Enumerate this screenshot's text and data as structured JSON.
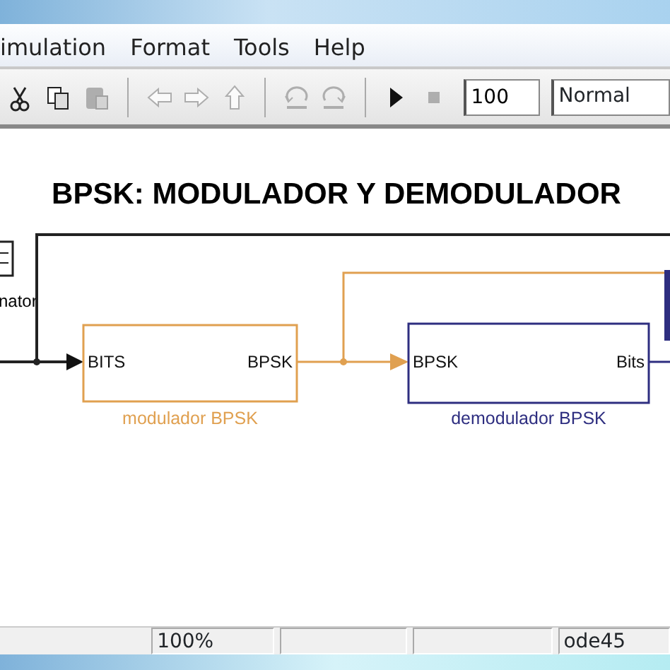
{
  "menu": [
    "imulation",
    "Format",
    "Tools",
    "Help"
  ],
  "toolbar": [
    {
      "kind": "cut",
      "disabled": false
    },
    {
      "kind": "copy",
      "disabled": false
    },
    {
      "kind": "paste",
      "disabled": true
    },
    {
      "kind": "sep"
    },
    {
      "kind": "back",
      "disabled": true
    },
    {
      "kind": "forward",
      "disabled": true
    },
    {
      "kind": "up",
      "disabled": true
    },
    {
      "kind": "sep"
    },
    {
      "kind": "undo",
      "disabled": true
    },
    {
      "kind": "redo",
      "disabled": true
    },
    {
      "kind": "sep"
    },
    {
      "kind": "play",
      "disabled": false
    },
    {
      "kind": "stop",
      "disabled": true
    }
  ],
  "stop_time": "100",
  "sim_mode": "Normal",
  "diagram": {
    "title": "BPSK: MODULADOR Y DEMODULADOR",
    "source_label": "nator",
    "blocks": [
      {
        "caption": "modulador BPSK",
        "color": "#e0a050",
        "input": "BITS",
        "output": "BPSK"
      },
      {
        "caption": "demodulador BPSK",
        "color": "#2e2e80",
        "input": "BPSK",
        "output": "Bits"
      }
    ]
  },
  "status_bar": {
    "zoom": "100%",
    "solver": "ode45"
  }
}
